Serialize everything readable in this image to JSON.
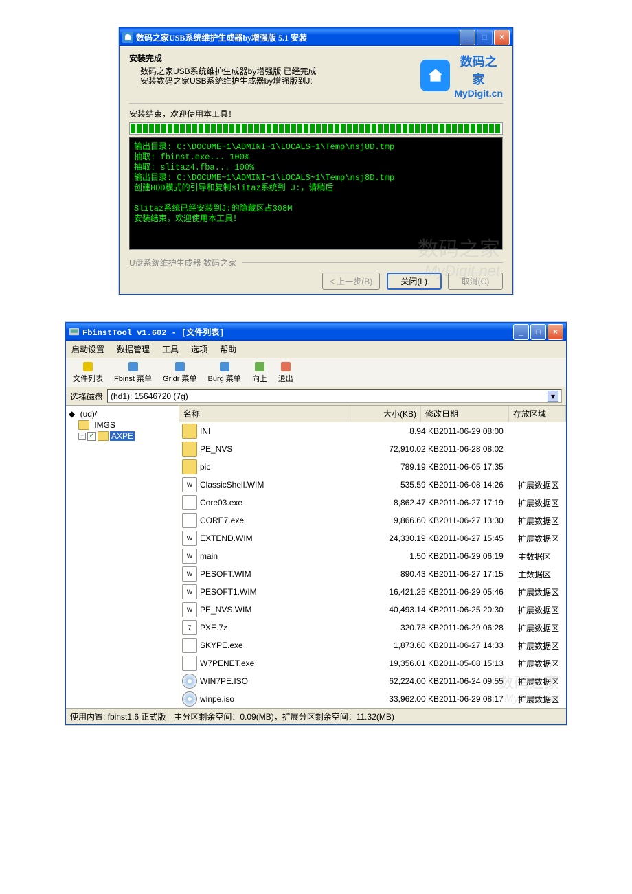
{
  "win1": {
    "title": "数码之家USB系统维护生成器by增强版  5.1  安装",
    "heading": "安装完成",
    "sub1": "数码之家USB系统维护生成器by增强版 已经完成",
    "sub2": "安装数码之家USB系统维护生成器by增强版到J:",
    "logo_cn": "数码之家",
    "logo_en": "MyDigit.cn",
    "progress_label": "安装结束，欢迎使用本工具！",
    "console_lines": "输出目录: C:\\DOCUME~1\\ADMINI~1\\LOCALS~1\\Temp\\nsj8D.tmp\n抽取: fbinst.exe... 100%\n抽取: slitaz4.fba... 100%\n输出目录: C:\\DOCUME~1\\ADMINI~1\\LOCALS~1\\Temp\\nsj8D.tmp\n创建HDD模式的引导和复制slitaz系统到 J:，请稍后\n\nSlitaz系统已经安装到J:的隐藏区占308M\n安装结束，欢迎使用本工具！",
    "group_label": "U盘系统维护生成器 数码之家",
    "btn_back": "< 上一步(B)",
    "btn_close": "关闭(L)",
    "btn_cancel": "取消(C)",
    "watermark_cn": "数码之家",
    "watermark_en": "MyDigit.net"
  },
  "win2": {
    "title": "FbinstTool v1.602 - [文件列表]",
    "menu": [
      "启动设置",
      "数据管理",
      "工具",
      "选项",
      "帮助"
    ],
    "tools": [
      "文件列表",
      "Fbinst 菜单",
      "Grldr 菜单",
      "Burg 菜单",
      "向上",
      "退出"
    ],
    "disk_label": "选择磁盘",
    "disk_value": "(hd1): 15646720 (7g)",
    "tree": {
      "root": "(ud)/",
      "n1": "IMGS",
      "n2": "AXPE"
    },
    "cols": {
      "name": "名称",
      "size": "大小(KB)",
      "date": "修改日期",
      "area": "存放区域"
    },
    "rows": [
      {
        "icon": "folder",
        "name": "INI",
        "size": "8.94 KB",
        "date": "2011-06-29 08:00",
        "area": ""
      },
      {
        "icon": "folder",
        "name": "PE_NVS",
        "size": "72,910.02 KB",
        "date": "2011-06-28 08:02",
        "area": ""
      },
      {
        "icon": "folder",
        "name": "pic",
        "size": "789.19 KB",
        "date": "2011-06-05 17:35",
        "area": ""
      },
      {
        "icon": "wim",
        "name": "ClassicShell.WIM",
        "size": "535.59 KB",
        "date": "2011-06-08 14:26",
        "area": "扩展数据区"
      },
      {
        "icon": "exe",
        "name": "Core03.exe",
        "size": "8,862.47 KB",
        "date": "2011-06-27 17:19",
        "area": "扩展数据区"
      },
      {
        "icon": "exe",
        "name": "CORE7.exe",
        "size": "9,866.60 KB",
        "date": "2011-06-27 13:30",
        "area": "扩展数据区"
      },
      {
        "icon": "wim",
        "name": "EXTEND.WIM",
        "size": "24,330.19 KB",
        "date": "2011-06-27 15:45",
        "area": "扩展数据区"
      },
      {
        "icon": "wim",
        "name": "main",
        "size": "1.50 KB",
        "date": "2011-06-29 06:19",
        "area": "主数据区"
      },
      {
        "icon": "wim",
        "name": "PESOFT.WIM",
        "size": "890.43 KB",
        "date": "2011-06-27 17:15",
        "area": "主数据区"
      },
      {
        "icon": "wim",
        "name": "PESOFT1.WIM",
        "size": "16,421.25 KB",
        "date": "2011-06-29 05:46",
        "area": "扩展数据区"
      },
      {
        "icon": "wim",
        "name": "PE_NVS.WIM",
        "size": "40,493.14 KB",
        "date": "2011-06-25 20:30",
        "area": "扩展数据区"
      },
      {
        "icon": "7z",
        "name": "PXE.7z",
        "size": "320.78 KB",
        "date": "2011-06-29 06:28",
        "area": "扩展数据区"
      },
      {
        "icon": "exe",
        "name": "SKYPE.exe",
        "size": "1,873.60 KB",
        "date": "2011-06-27 14:33",
        "area": "扩展数据区"
      },
      {
        "icon": "exe",
        "name": "W7PENET.exe",
        "size": "19,356.01 KB",
        "date": "2011-05-08 15:13",
        "area": "扩展数据区"
      },
      {
        "icon": "cd",
        "name": "WIN7PE.ISO",
        "size": "62,224.00 KB",
        "date": "2011-06-24 09:55",
        "area": "扩展数据区"
      },
      {
        "icon": "cd",
        "name": "winpe.iso",
        "size": "33,962.00 KB",
        "date": "2011-06-29 08:17",
        "area": "扩展数据区"
      }
    ],
    "status1": "使用内置: fbinst1.6 正式版",
    "status2": "主分区剩余空间：0.09(MB)，扩展分区剩余空间：11.32(MB)",
    "watermark_cn": "数码之家",
    "watermark_en": "MyDigit.net"
  }
}
